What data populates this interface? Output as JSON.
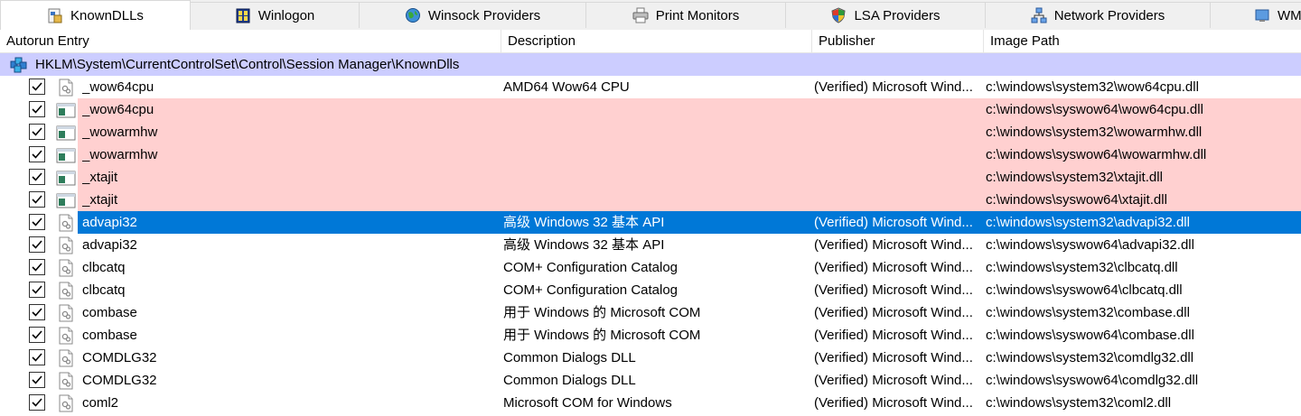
{
  "tabs": [
    {
      "label": "KnownDLLs",
      "icon": "knowndlls-icon",
      "active": true
    },
    {
      "label": "Winlogon",
      "icon": "winlogon-icon"
    },
    {
      "label": "Winsock Providers",
      "icon": "winsock-globe-icon"
    },
    {
      "label": "Print Monitors",
      "icon": "printer-icon"
    },
    {
      "label": "LSA Providers",
      "icon": "shield-icon"
    },
    {
      "label": "Network Providers",
      "icon": "network-icon"
    },
    {
      "label": "WM",
      "icon": "wmi-icon"
    }
  ],
  "columns": {
    "entry": "Autorun Entry",
    "description": "Description",
    "publisher": "Publisher",
    "path": "Image Path"
  },
  "group": {
    "label": "HKLM\\System\\CurrentControlSet\\Control\\Session Manager\\KnownDlls",
    "color": "#cccdff"
  },
  "colors": {
    "not_found": "#ffd0d0",
    "selected": "#0078d7"
  },
  "rows": [
    {
      "entry": "_wow64cpu",
      "description": "AMD64 Wow64 CPU",
      "publisher": "(Verified) Microsoft Wind...",
      "path": "c:\\windows\\system32\\wow64cpu.dll",
      "state": "normal",
      "icon": "dll-file-icon"
    },
    {
      "entry": "_wow64cpu",
      "description": "",
      "publisher": "",
      "path": "c:\\windows\\syswow64\\wow64cpu.dll",
      "state": "bad",
      "icon": "app-window-icon"
    },
    {
      "entry": "_wowarmhw",
      "description": "",
      "publisher": "",
      "path": "c:\\windows\\system32\\wowarmhw.dll",
      "state": "bad",
      "icon": "app-window-icon"
    },
    {
      "entry": "_wowarmhw",
      "description": "",
      "publisher": "",
      "path": "c:\\windows\\syswow64\\wowarmhw.dll",
      "state": "bad",
      "icon": "app-window-icon"
    },
    {
      "entry": "_xtajit",
      "description": "",
      "publisher": "",
      "path": "c:\\windows\\system32\\xtajit.dll",
      "state": "bad",
      "icon": "app-window-icon"
    },
    {
      "entry": "_xtajit",
      "description": "",
      "publisher": "",
      "path": "c:\\windows\\syswow64\\xtajit.dll",
      "state": "bad",
      "icon": "app-window-icon"
    },
    {
      "entry": "advapi32",
      "description": "高级 Windows 32 基本 API",
      "publisher": "(Verified) Microsoft Wind...",
      "path": "c:\\windows\\system32\\advapi32.dll",
      "state": "selected",
      "icon": "dll-file-icon"
    },
    {
      "entry": "advapi32",
      "description": "高级 Windows 32 基本 API",
      "publisher": "(Verified) Microsoft Wind...",
      "path": "c:\\windows\\syswow64\\advapi32.dll",
      "state": "normal",
      "icon": "dll-file-icon"
    },
    {
      "entry": "clbcatq",
      "description": "COM+ Configuration Catalog",
      "publisher": "(Verified) Microsoft Wind...",
      "path": "c:\\windows\\system32\\clbcatq.dll",
      "state": "normal",
      "icon": "dll-file-icon"
    },
    {
      "entry": "clbcatq",
      "description": "COM+ Configuration Catalog",
      "publisher": "(Verified) Microsoft Wind...",
      "path": "c:\\windows\\syswow64\\clbcatq.dll",
      "state": "normal",
      "icon": "dll-file-icon"
    },
    {
      "entry": "combase",
      "description": "用于 Windows 的 Microsoft COM",
      "publisher": "(Verified) Microsoft Wind...",
      "path": "c:\\windows\\system32\\combase.dll",
      "state": "normal",
      "icon": "dll-file-icon"
    },
    {
      "entry": "combase",
      "description": "用于 Windows 的 Microsoft COM",
      "publisher": "(Verified) Microsoft Wind...",
      "path": "c:\\windows\\syswow64\\combase.dll",
      "state": "normal",
      "icon": "dll-file-icon"
    },
    {
      "entry": "COMDLG32",
      "description": "Common Dialogs DLL",
      "publisher": "(Verified) Microsoft Wind...",
      "path": "c:\\windows\\system32\\comdlg32.dll",
      "state": "normal",
      "icon": "dll-file-icon"
    },
    {
      "entry": "COMDLG32",
      "description": "Common Dialogs DLL",
      "publisher": "(Verified) Microsoft Wind...",
      "path": "c:\\windows\\syswow64\\comdlg32.dll",
      "state": "normal",
      "icon": "dll-file-icon"
    },
    {
      "entry": "coml2",
      "description": "Microsoft COM for Windows",
      "publisher": "(Verified) Microsoft Wind...",
      "path": "c:\\windows\\system32\\coml2.dll",
      "state": "normal",
      "icon": "dll-file-icon"
    }
  ]
}
